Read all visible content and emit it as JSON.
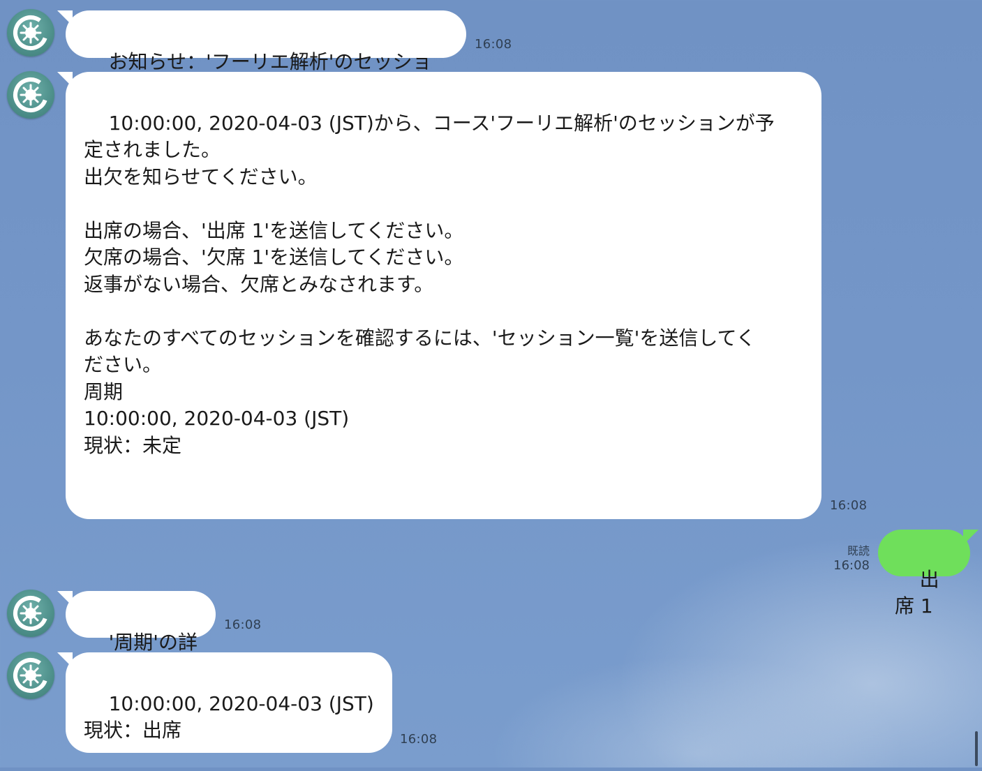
{
  "messages": [
    {
      "sender": "bot",
      "avatar_icon": "bot-gear-icon",
      "text": "お知らせ：'フーリエ解析'のセッション",
      "time": "16:08"
    },
    {
      "sender": "bot",
      "avatar_icon": "bot-gear-icon",
      "text": "10:00:00, 2020-04-03 (JST)から、コース'フーリエ解析'のセッションが予\n定されました。\n出欠を知らせてください。\n\n出席の場合、'出席 1'を送信してください。\n欠席の場合、'欠席 1'を送信してください。\n返事がない場合、欠席とみなされます。\n\nあなたのすべてのセッションを確認するには、'セッション一覧'を送信してく\nださい。\n周期\n10:00:00, 2020-04-03 (JST)\n現状：未定",
      "time": "16:08"
    },
    {
      "sender": "me",
      "text": "出席 1",
      "read_label": "既読",
      "time": "16:08"
    },
    {
      "sender": "bot",
      "avatar_icon": "bot-gear-icon",
      "text": "'周期'の詳細",
      "time": "16:08"
    },
    {
      "sender": "bot",
      "avatar_icon": "bot-gear-icon",
      "text": "10:00:00, 2020-04-03 (JST)\n現状：出席",
      "time": "16:08"
    }
  ],
  "colors": {
    "background": "#7496c8",
    "incoming_bubble": "#ffffff",
    "outgoing_bubble": "#6fdf5b",
    "avatar": "#4d8f8a"
  }
}
